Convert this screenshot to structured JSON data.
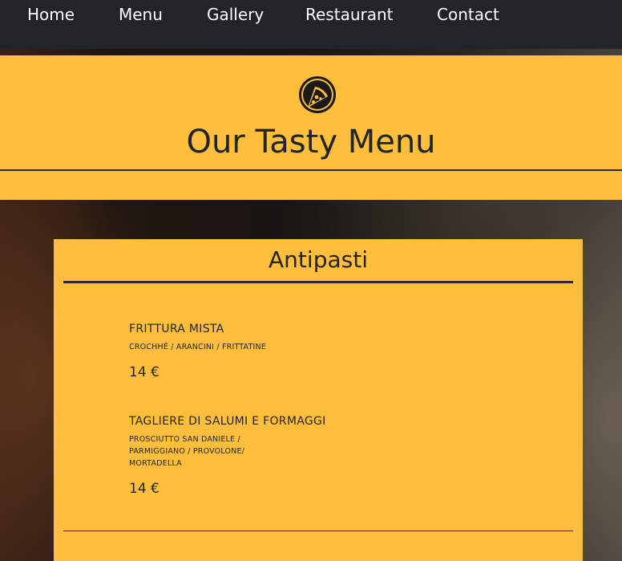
{
  "nav": {
    "items": [
      {
        "label": "Home"
      },
      {
        "label": "Menu"
      },
      {
        "label": "Gallery"
      },
      {
        "label": "Restaurant"
      },
      {
        "label": "Contact"
      }
    ]
  },
  "header": {
    "logo_icon": "pizza-slice-icon",
    "title": "Our Tasty Menu"
  },
  "section": {
    "title": "Antipasti",
    "dishes": [
      {
        "name": "FRITTURA MISTA",
        "description": "CROCHHÉ / ARANCINI / FRITTATINE",
        "price": "14 €"
      },
      {
        "name": "TAGLIERE DI SALUMI E FORMAGGI",
        "description": "PROSCIUTTO SAN DANIELE / PARMIGGIANO / PROVOLONE/ MORTADELLA",
        "price": "14 €"
      }
    ]
  },
  "colors": {
    "accent": "#ffbe3c",
    "navbar": "#212529",
    "text": "#212529"
  }
}
